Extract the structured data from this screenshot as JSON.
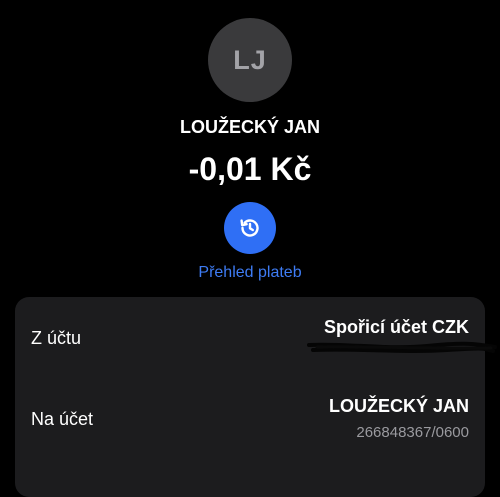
{
  "counterparty": {
    "initials": "LJ",
    "name": "LOUŽECKÝ JAN"
  },
  "transaction": {
    "amount": "-0,01 Kč"
  },
  "history": {
    "icon": "history-icon",
    "label": "Přehled plateb"
  },
  "details": {
    "from_account": {
      "label": "Z účtu",
      "value": "Spořicí účet CZK"
    },
    "to_account": {
      "label": "Na účet",
      "name": "LOUŽECKÝ JAN",
      "number": "266848367/0600"
    }
  },
  "colors": {
    "background": "#000000",
    "card": "#1c1c1e",
    "accent": "#2f6ff5",
    "link": "#3e7cf4",
    "secondary_text": "#9a9a9f",
    "avatar_bg": "#3a3a3c"
  }
}
